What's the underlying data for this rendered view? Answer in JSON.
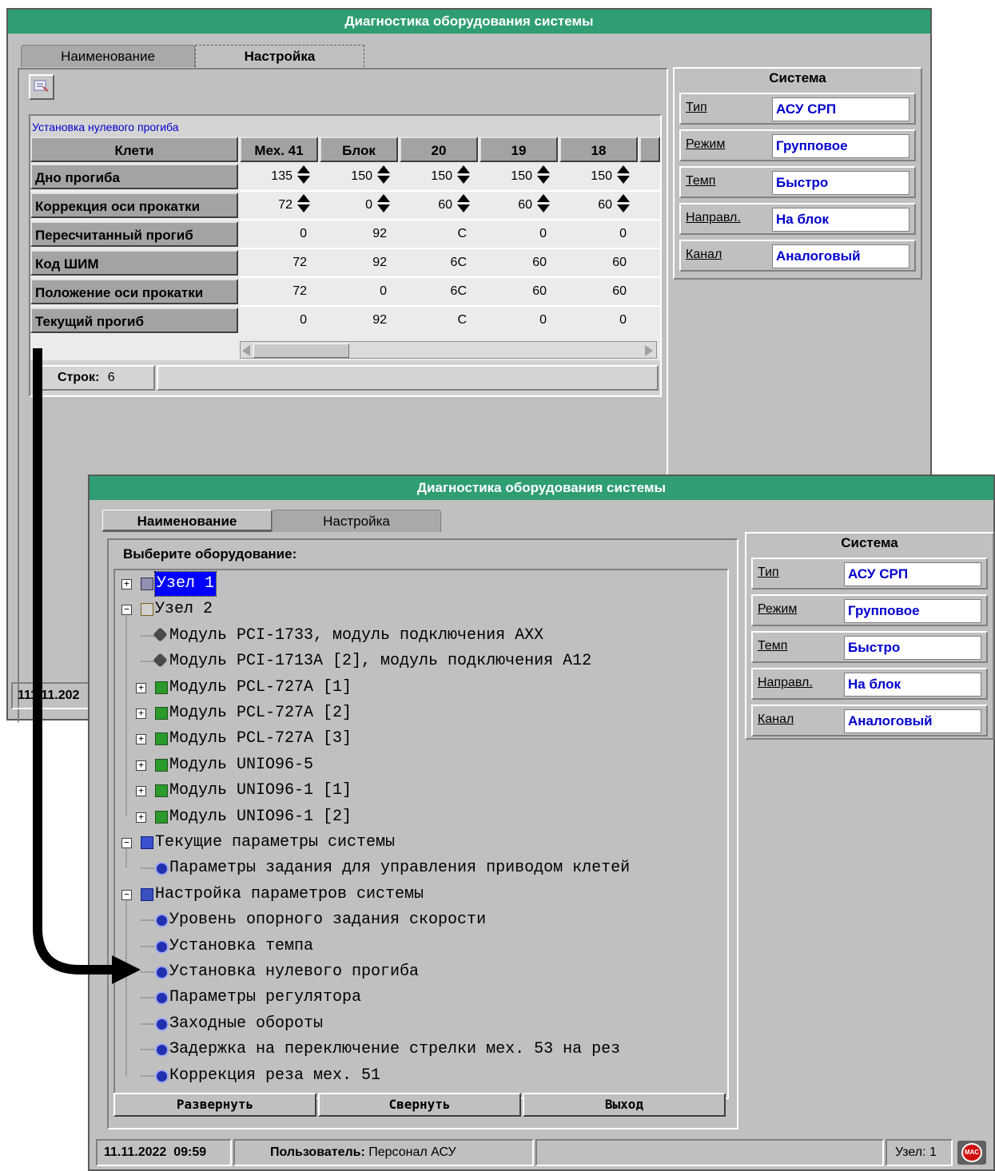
{
  "back_window": {
    "title": "Диагностика оборудования системы",
    "tabs": [
      "Наименование",
      "Настройка"
    ],
    "active_tab": "Настройка",
    "grid_caption": "Установка нулевого прогиба",
    "columns": [
      "Клети",
      "Мех. 41",
      "Блок",
      "20",
      "19",
      "18"
    ],
    "rows": [
      {
        "label": "Дно прогиба",
        "values": [
          "135",
          "150",
          "150",
          "150",
          "150"
        ],
        "spinner": true
      },
      {
        "label": "Коррекция оси прокатки",
        "values": [
          "72",
          "0",
          "60",
          "60",
          "60"
        ],
        "spinner": true
      },
      {
        "label": "Пересчитанный прогиб",
        "values": [
          "0",
          "92",
          "C",
          "0",
          "0"
        ],
        "spinner": false
      },
      {
        "label": "Код ШИМ",
        "values": [
          "72",
          "92",
          "6C",
          "60",
          "60"
        ],
        "spinner": false
      },
      {
        "label": "Положение оси прокатки",
        "values": [
          "72",
          "0",
          "6C",
          "60",
          "60"
        ],
        "spinner": false
      },
      {
        "label": "Текущий прогиб",
        "values": [
          "0",
          "92",
          "C",
          "0",
          "0"
        ],
        "spinner": false
      }
    ],
    "rows_label": "Строк:",
    "rows_count": "6",
    "status_date": "11.11.202",
    "status_date_prefix": "1"
  },
  "system": {
    "title": "Система",
    "fields": [
      {
        "label": "Тип",
        "value": "АСУ СРП"
      },
      {
        "label": "Режим",
        "value": "Групповое"
      },
      {
        "label": "Темп",
        "value": "Быстро"
      },
      {
        "label": "Направл.",
        "value": "На блок"
      },
      {
        "label": "Канал",
        "value": "Аналоговый"
      }
    ]
  },
  "front_window": {
    "title": "Диагностика оборудования системы",
    "tabs": [
      "Наименование",
      "Настройка"
    ],
    "active_tab": "Наименование",
    "select_label": "Выберите оборудование:",
    "tree": [
      {
        "text": "Узел 1",
        "icon": "computer-icon",
        "expander": "+",
        "selected": true
      },
      {
        "text": "Узел 2",
        "icon": "rack-icon",
        "expander": "-"
      },
      {
        "text": "Модуль PCI-1733, модуль подключения AXX",
        "icon": "plug-icon"
      },
      {
        "text": "Модуль PCI-1713A [2], модуль подключения A12",
        "icon": "plug-icon"
      },
      {
        "text": "Модуль PCL-727A [1]",
        "icon": "card-icon",
        "expander": "+"
      },
      {
        "text": "Модуль PCL-727A [2]",
        "icon": "card-icon",
        "expander": "+"
      },
      {
        "text": "Модуль PCL-727A [3]",
        "icon": "card-icon",
        "expander": "+"
      },
      {
        "text": "Модуль UNIO96-5",
        "icon": "card-icon",
        "expander": "+"
      },
      {
        "text": "Модуль UNIO96-1 [1]",
        "icon": "card-icon",
        "expander": "+"
      },
      {
        "text": "Модуль UNIO96-1 [2]",
        "icon": "card-icon",
        "expander": "+"
      },
      {
        "text": "Текущие параметры системы",
        "icon": "table-icon",
        "expander": "-"
      },
      {
        "text": "Параметры задания для управления приводом клетей",
        "icon": "parameter-icon"
      },
      {
        "text": "Настройка параметров системы",
        "icon": "edit-icon",
        "expander": "-"
      },
      {
        "text": "Уровень опорного задания скорости",
        "icon": "parameter-icon"
      },
      {
        "text": "Установка темпа",
        "icon": "parameter-icon"
      },
      {
        "text": "Установка нулевого прогиба",
        "icon": "parameter-icon"
      },
      {
        "text": "Параметры регулятора",
        "icon": "parameter-icon"
      },
      {
        "text": "Заходные обороты",
        "icon": "parameter-icon"
      },
      {
        "text": "Задержка на переключение стрелки мех. 53 на рез",
        "icon": "parameter-icon"
      },
      {
        "text": "Коррекция реза мех. 51",
        "icon": "parameter-icon"
      }
    ],
    "buttons": [
      "Развернуть",
      "Свернуть",
      "Выход"
    ],
    "status": {
      "datetime": "11.11.2022  09:59",
      "user_label": "Пользователь:",
      "user": "Персонал АСУ",
      "node": "Узел: 1",
      "logo_text": "МАС"
    }
  },
  "colors": {
    "titlebar": "#2f9e73",
    "value_text": "#0000cc",
    "window_bg": "#c0c0c0",
    "selection": "#0000ff"
  }
}
